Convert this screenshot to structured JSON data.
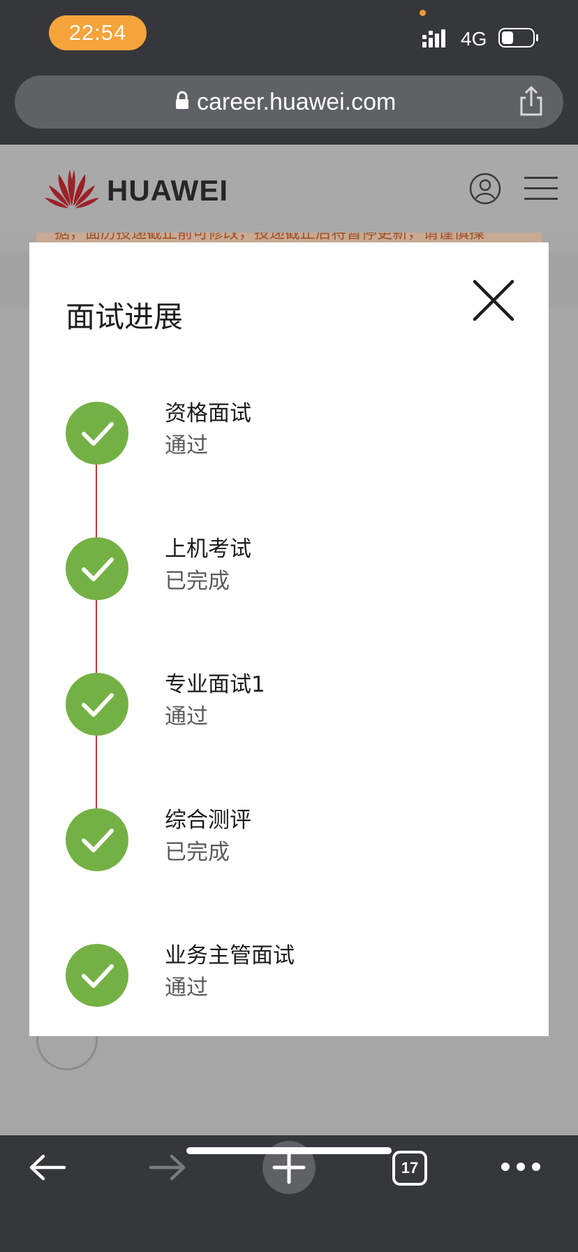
{
  "status_bar": {
    "time": "22:54",
    "network": "4G",
    "accent_color": "#f5a33b"
  },
  "browser": {
    "url": "career.huawei.com",
    "open_tabs": "17"
  },
  "site": {
    "brand": "HUAWEI",
    "notice_fragment": "据，面历投递截止前可修改，投递截止后将暂停更新，请谨慎操"
  },
  "modal": {
    "title": "面试进展",
    "steps": [
      {
        "title": "资格面试",
        "status": "通过"
      },
      {
        "title": "上机考试",
        "status": "已完成"
      },
      {
        "title": "专业面试1",
        "status": "通过"
      },
      {
        "title": "综合测评",
        "status": "已完成"
      },
      {
        "title": "业务主管面试",
        "status": "通过"
      }
    ],
    "colors": {
      "check_circle": "#74b145",
      "timeline": "#c0392b"
    }
  },
  "icons": [
    "lock-icon",
    "share-icon",
    "huawei-logo-icon",
    "user-icon",
    "menu-icon",
    "close-icon",
    "check-icon",
    "back-arrow-icon",
    "forward-arrow-icon",
    "plus-icon",
    "more-icon"
  ]
}
